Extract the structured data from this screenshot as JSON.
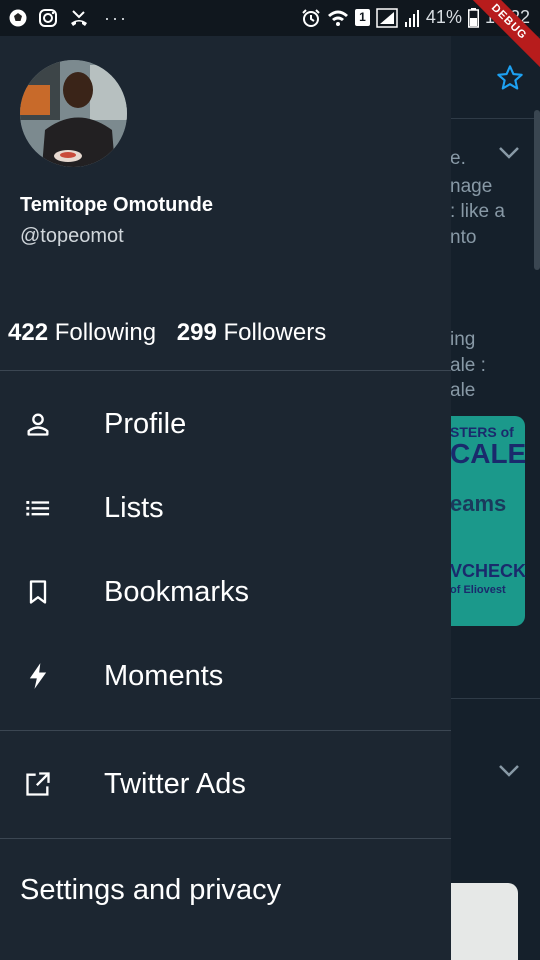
{
  "status_bar": {
    "battery_percent": "41%",
    "time": "16:22",
    "sim_badge": "1",
    "more": "···",
    "debug_label": "DEBUG"
  },
  "drawer": {
    "profile": {
      "name": "Temitope Omotunde",
      "handle": "@topeomot",
      "following_count": "422",
      "following_label": "Following",
      "followers_count": "299",
      "followers_label": "Followers"
    },
    "menu": {
      "profile": "Profile",
      "lists": "Lists",
      "bookmarks": "Bookmarks",
      "moments": "Moments",
      "twitter_ads": "Twitter Ads",
      "settings": "Settings and privacy"
    }
  },
  "background": {
    "text_lines": [
      "e.",
      "nage",
      ": like a",
      "nto",
      "ing",
      "ale :",
      "ale"
    ],
    "card_lines": [
      "STERS of",
      "CALE",
      "eams",
      "VCHECK",
      "of Eliovest"
    ]
  },
  "colors": {
    "drawer_bg": "#1c2631",
    "accent": "#1da1f2",
    "card_teal": "#1b998b"
  },
  "icons": [
    "person-icon",
    "list-icon",
    "bookmark-icon",
    "lightning-icon",
    "external-link-icon",
    "star-icon"
  ]
}
